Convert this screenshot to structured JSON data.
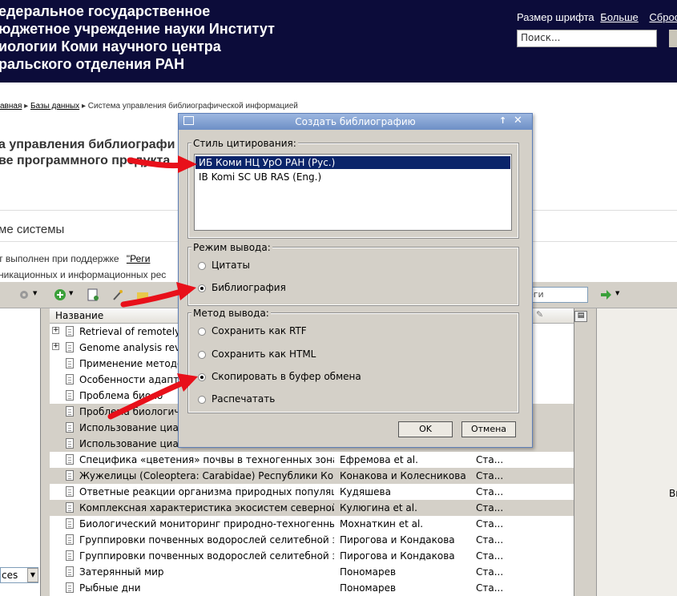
{
  "header": {
    "org_lines": [
      "едеральное государственное",
      "юджетное учреждение науки Институт",
      "иологии Коми научного центра",
      "ральского отделения РАН"
    ],
    "font_size_label": "Размер шрифта",
    "larger_link": "Больше",
    "reset_link": "Сброс",
    "search_placeholder": "Поиск..."
  },
  "breadcrumb": {
    "home": "авная",
    "databases": "Базы данных",
    "current": "Система управления библиографической информацией"
  },
  "page": {
    "title_line1": "а управления библиографи",
    "title_line2": "ве программного продукта",
    "section_title": "ме системы",
    "text_line1_a": "т   выполнен   при   поддержке",
    "text_line1_link": "\"Реги",
    "text_line2": "никационных и информационных рес"
  },
  "toolbar": {
    "filter_text": "еги"
  },
  "table": {
    "column_name": "Название",
    "rows": [
      {
        "name": "Retrieval of remotely s",
        "author": "",
        "status": "",
        "expand": true
      },
      {
        "name": "Genome analysis revi",
        "author": "",
        "status": "",
        "expand": true
      },
      {
        "name": "Применение методо",
        "author": "",
        "status": "",
        "expand": false
      },
      {
        "name": "Особенности адапт",
        "author": "",
        "status": "",
        "expand": false
      },
      {
        "name": "Проблема биоло",
        "author": "",
        "status": "",
        "expand": false
      },
      {
        "name": "Проблема биологиче",
        "author": "",
        "status": "",
        "expand": false
      },
      {
        "name": "Использование циан",
        "author": "",
        "status": "",
        "expand": false
      },
      {
        "name": "Использование циан",
        "author": "",
        "status": "",
        "expand": false
      },
      {
        "name": "Специфика «цветения» почвы в техногенных зона...",
        "author": "Ефремова et al.",
        "status": "Ста...",
        "expand": false
      },
      {
        "name": "Жужелицы (Coleoptera: Carabidae) Республики Коми",
        "author": "Конакова и Колесникова",
        "status": "Ста...",
        "expand": false
      },
      {
        "name": "Ответные реакции организма природных популяци...",
        "author": "Кудяшева",
        "status": "Ста...",
        "expand": false
      },
      {
        "name": "Комплексная характеристика экосистем северной ...",
        "author": "Кулюгина et al.",
        "status": "Ста...",
        "expand": false
      },
      {
        "name": "Биологический мониторинг природно-техногенных...",
        "author": "Мохнаткин et al.",
        "status": "Ста...",
        "expand": false
      },
      {
        "name": "Группировки почвенных водорослей селитебной з...",
        "author": "Пирогова и Кондакова",
        "status": "Ста...",
        "expand": false
      },
      {
        "name": "Группировки почвенных водорослей селитебной з...",
        "author": "Пирогова и Кондакова",
        "status": "Ста...",
        "expand": false
      },
      {
        "name": "Затерянный мир",
        "author": "Пономарев",
        "status": "Ста...",
        "expand": false
      },
      {
        "name": "Рыбные дни",
        "author": "Пономарев",
        "status": "Ста...",
        "expand": false
      }
    ]
  },
  "left_pane": {
    "input_text": "ces"
  },
  "far_right": {
    "text": "Вы"
  },
  "dialog": {
    "title": "Создать библиографию",
    "style_legend": "Стиль цитирования:",
    "styles": [
      "ИБ Коми НЦ УрО РАН (Рус.)",
      "IB Komi SC UB RAS (Eng.)"
    ],
    "output_mode_legend": "Режим вывода:",
    "output_modes": [
      "Цитаты",
      "Библиография"
    ],
    "output_mode_selected": 1,
    "method_legend": "Метод вывода:",
    "methods": [
      "Сохранить как RTF",
      "Сохранить как HTML",
      "Скопировать в буфер обмена",
      "Распечатать"
    ],
    "method_selected": 2,
    "ok_label": "OK",
    "cancel_label": "Отмена"
  },
  "colors": {
    "header_bg": "#0c0c3a",
    "selection": "#0a246a",
    "titlebar": "#7d9dd0",
    "arrow": "#e8101a"
  }
}
